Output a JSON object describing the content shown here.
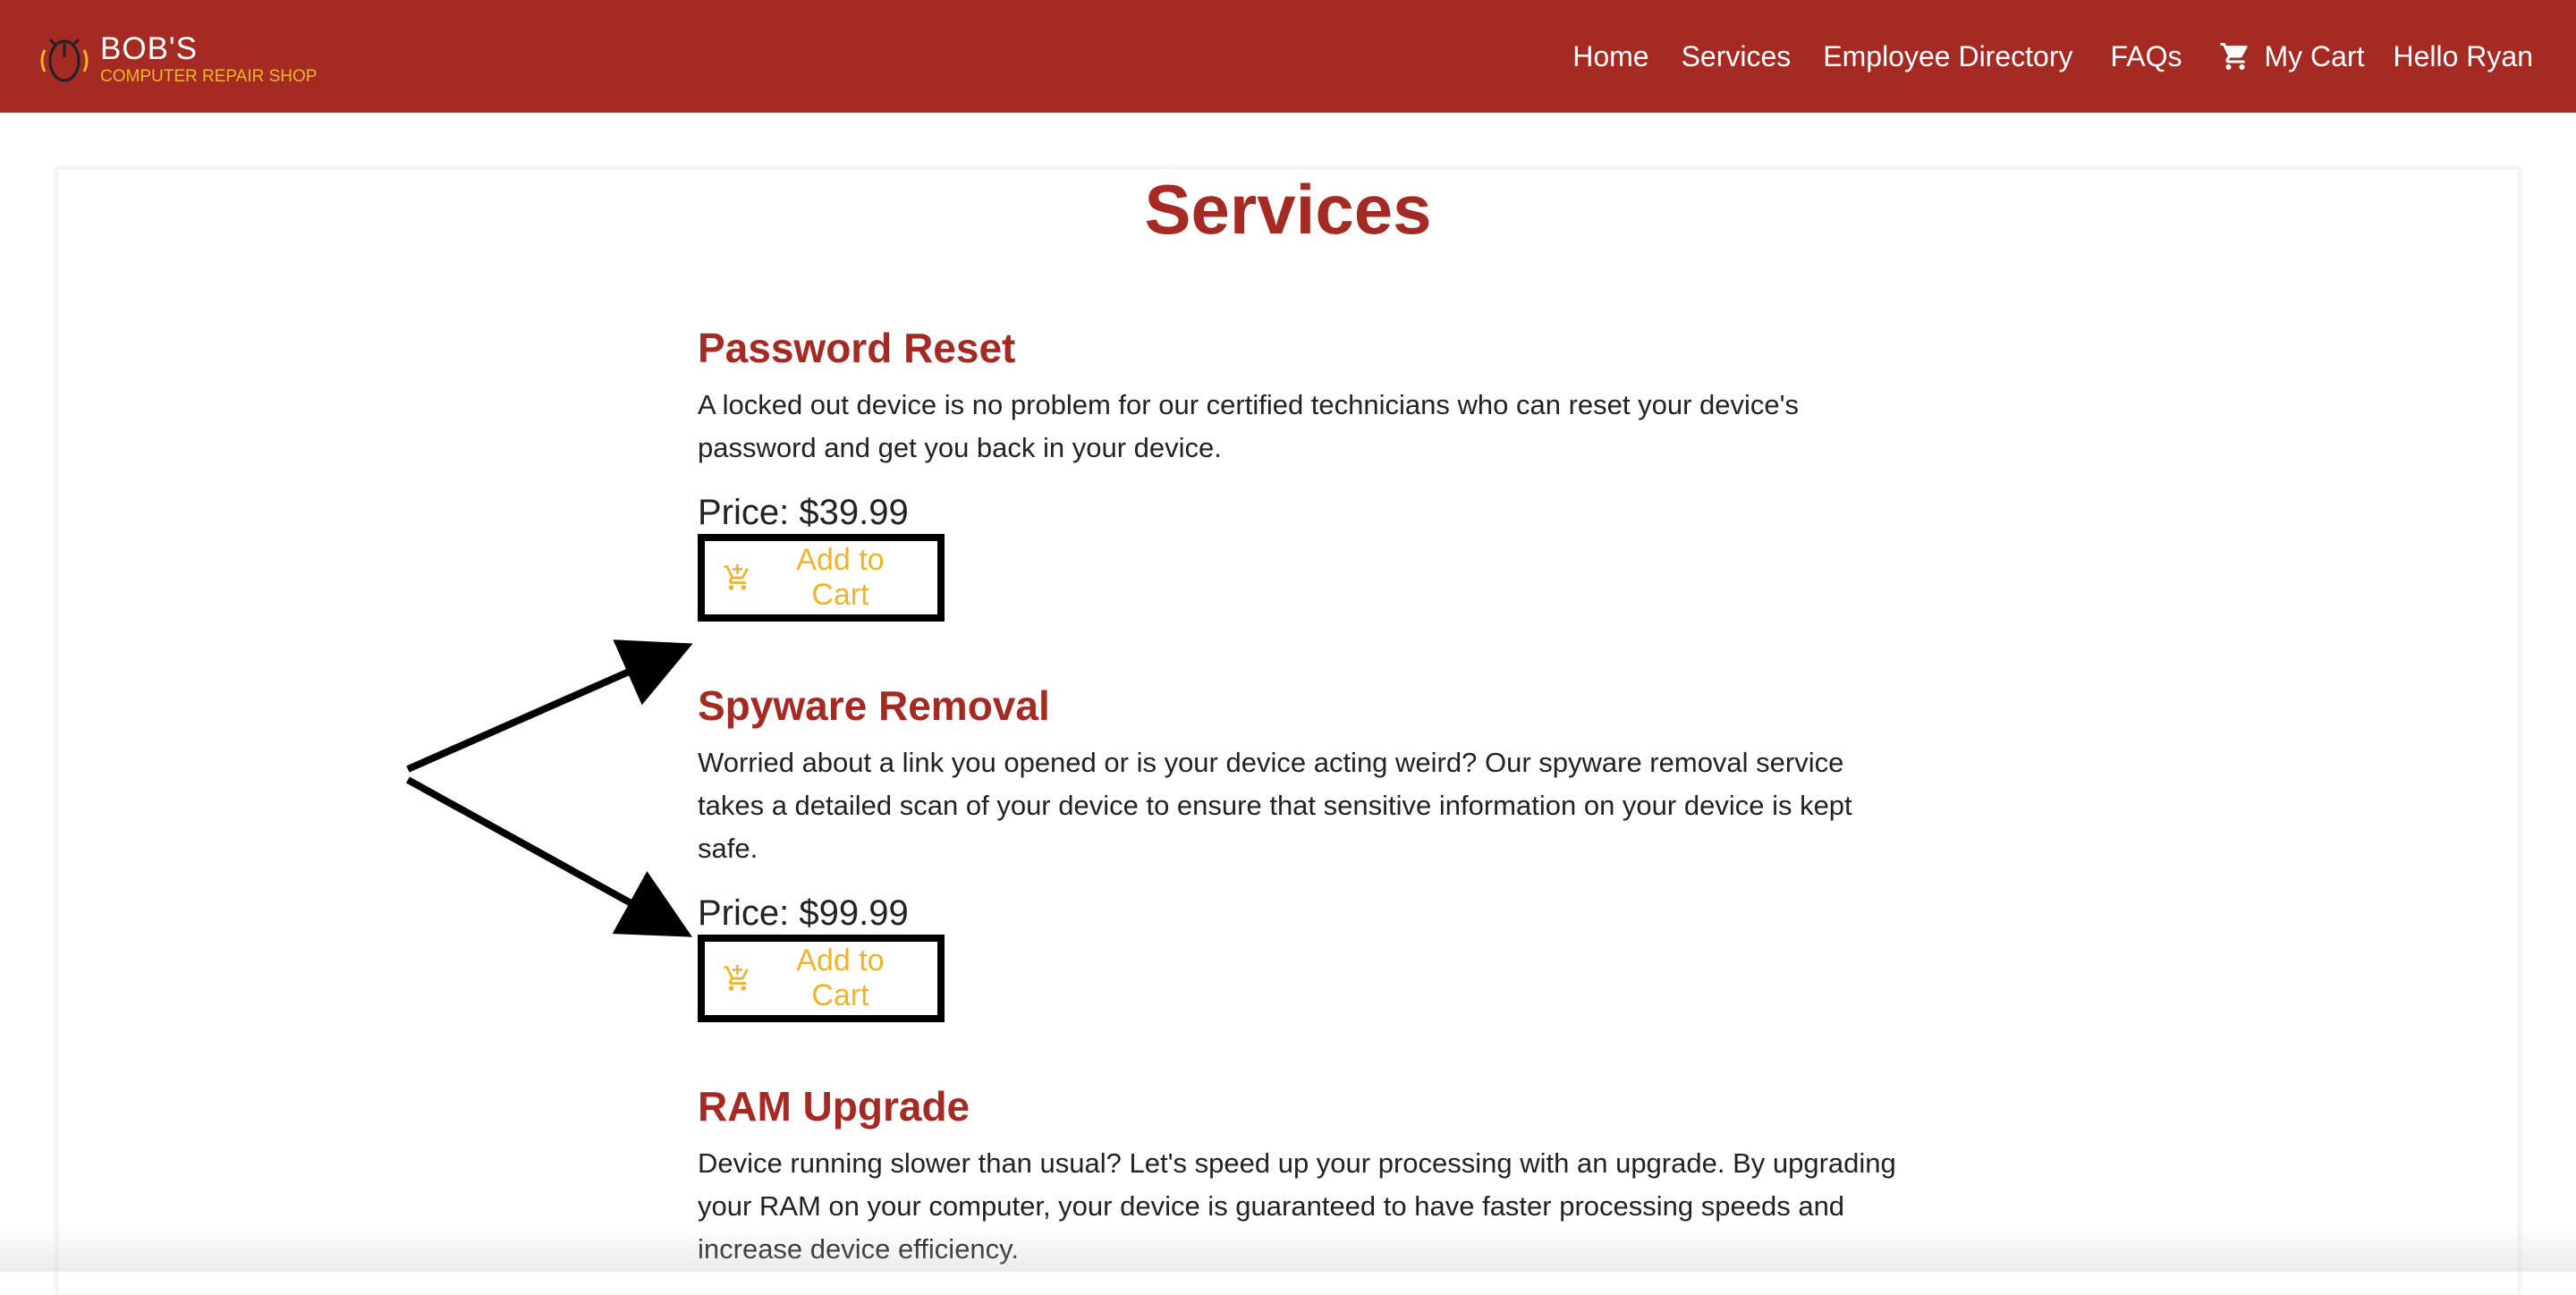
{
  "header": {
    "brand_title": "BOB'S",
    "brand_subtitle": "COMPUTER REPAIR SHOP",
    "logo_icon": "mouse-logo-icon",
    "nav": {
      "home": "Home",
      "services": "Services",
      "employee_directory": "Employee Directory",
      "faqs": "FAQs",
      "my_cart": "My Cart",
      "greeting": "Hello Ryan"
    }
  },
  "page": {
    "title": "Services"
  },
  "services": [
    {
      "title": "Password Reset",
      "description": "A locked out device is no problem for our certified technicians who can reset your device's password and get you back in your device.",
      "price": "Price: $39.99",
      "button": "Add to Cart"
    },
    {
      "title": "Spyware Removal",
      "description": "Worried about a link you opened or is your device acting weird? Our spyware removal service takes a detailed scan of your device to ensure that sensitive information on your device is kept safe.",
      "price": "Price: $99.99",
      "button": "Add to Cart"
    },
    {
      "title": "RAM Upgrade",
      "description": "Device running slower than usual? Let's speed up your processing with an upgrade. By upgrading your RAM on your computer, your device is guaranteed to have faster processing speeds and increase device efficiency."
    }
  ],
  "colors": {
    "brand_red": "#a52a24",
    "accent_yellow": "#f0b429",
    "text": "#222222"
  }
}
